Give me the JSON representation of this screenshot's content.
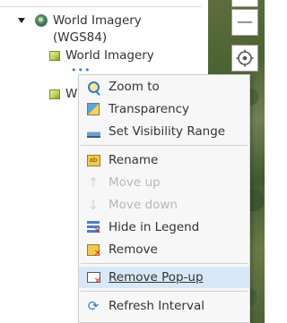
{
  "tree": {
    "root_label_line1": "World Imagery",
    "root_label_line2": "(WGS84)",
    "child1_label": "World Imagery",
    "child2_label_partial": "W",
    "more_dots": "•••"
  },
  "menu": {
    "items": [
      {
        "label": "Zoom to",
        "icon": "zoom-to-icon",
        "enabled": true
      },
      {
        "label": "Transparency",
        "icon": "transparency-icon",
        "enabled": true
      },
      {
        "label": "Set Visibility Range",
        "icon": "visibility-range-icon",
        "enabled": true
      },
      {
        "label": "Rename",
        "icon": "rename-icon",
        "enabled": true
      },
      {
        "label": "Move up",
        "icon": "arrow-up-icon",
        "enabled": false
      },
      {
        "label": "Move down",
        "icon": "arrow-down-icon",
        "enabled": false
      },
      {
        "label": "Hide in Legend",
        "icon": "hide-legend-icon",
        "enabled": true
      },
      {
        "label": "Remove",
        "icon": "remove-icon",
        "enabled": true
      },
      {
        "label": "Remove Pop-up",
        "icon": "remove-popup-icon",
        "enabled": true,
        "hovered": true
      },
      {
        "label": "Refresh Interval",
        "icon": "refresh-icon",
        "enabled": true
      }
    ],
    "icon_glyphs": {
      "arrow_up": "↑",
      "arrow_down": "↓",
      "refresh": "⟳",
      "x": "✕",
      "rename_tag": "ab"
    }
  },
  "map": {
    "minus_glyph": "—",
    "top_glyph": "╹╹"
  },
  "colors": {
    "hover": "#d9e8f6",
    "disabled_text": "#b7b7b7",
    "accent": "#2f7ec9"
  }
}
